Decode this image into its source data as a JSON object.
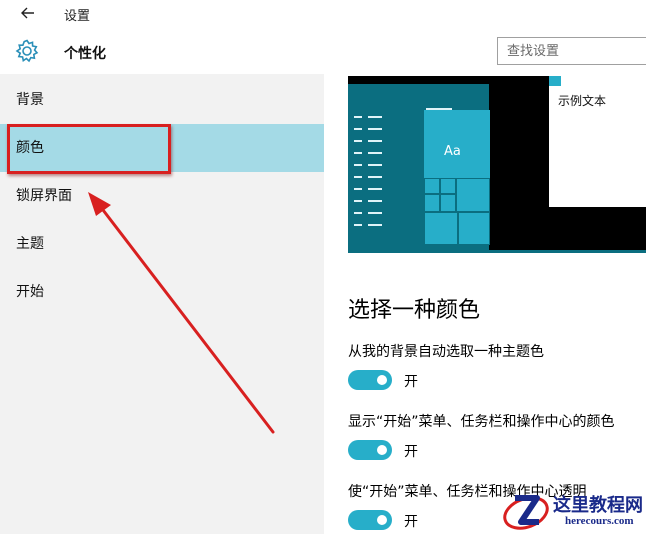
{
  "window": {
    "title": "设置"
  },
  "header": {
    "title": "个性化"
  },
  "search": {
    "placeholder": "查找设置"
  },
  "sidebar": {
    "items": [
      {
        "label": "背景"
      },
      {
        "label": "颜色",
        "selected": true
      },
      {
        "label": "锁屏界面"
      },
      {
        "label": "主题"
      },
      {
        "label": "开始"
      }
    ]
  },
  "preview": {
    "sample_text": "示例文本",
    "tile_label": "Aa"
  },
  "main": {
    "section_title": "选择一种颜色",
    "options": [
      {
        "label": "从我的背景自动选取一种主题色",
        "state": "开"
      },
      {
        "label": "显示“开始”菜单、任务栏和操作中心的颜色",
        "state": "开"
      },
      {
        "label": "使“开始”菜单、任务栏和操作中心透明",
        "state": "开"
      }
    ]
  },
  "watermark": {
    "text": "这里教程网",
    "url_text": "herecours.com"
  },
  "colors": {
    "accent": "#27aec9",
    "selection": "#a4dae6",
    "annotation": "#d82020",
    "preview_dark": "#0b6e80"
  }
}
